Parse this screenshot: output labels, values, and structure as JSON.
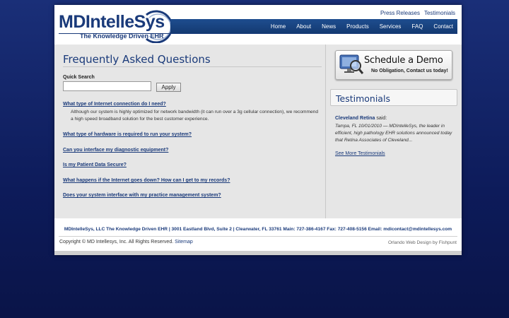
{
  "header": {
    "logo_text": "MDIntelleSys",
    "logo_tagline": "The Knowledge Driven EHR",
    "top_links": [
      "Press Releases",
      "Testimonials"
    ],
    "nav": [
      "Home",
      "About",
      "News",
      "Products",
      "Services",
      "FAQ",
      "Contact"
    ]
  },
  "main": {
    "title": "Frequently Asked Questions",
    "search_label": "Quick Search",
    "search_value": "",
    "search_button": "Apply",
    "questions": [
      "What type of Internet connection do I need?",
      "What type of hardware is required to run your system?",
      "Can you interface my diagnostic equipment?",
      "Is my Patient Data Secure?",
      "What happens if the Internet goes down? How can I get to my records?",
      "Does your system interface with my practice management system?"
    ],
    "first_answer": "Although our system is highly optimized for network bandwidth (it can run over a 3g cellular connection), we recommend a high speed broadband solution for the best customer experience."
  },
  "sidebar": {
    "demo_title": "Schedule a Demo",
    "demo_subtitle": "No Obligation, Contact us today!",
    "testimonials_title": "Testimonials",
    "testimonial_author": "Cleveland Retina",
    "testimonial_said": "said:",
    "testimonial_text": "Tampa, FL 10/01/2010 — MDIntelleSys, the leader in efficient, high pathology EHR solutions announced today that Retina Associates of Cleveland...",
    "see_more": "See More Testimonials"
  },
  "footer": {
    "address": "MDIntelleSys, LLC The Knowledge Driven EHR | 3001 Eastland Blvd, Suite 2 | Clearwater, FL 33761 Main: 727-386-4167 Fax: 727-408-5156 Email: mdicontact@mdintellesys.com",
    "copyright": "Copyright © MD Intellesys, Inc. All Rights Reserved.",
    "sitemap": "Sitemap",
    "credit_link": "Orlando Web Design",
    "credit_by": "by Fishpunt"
  },
  "colors": {
    "brand_blue": "#1a3a7a",
    "nav_blue": "#1e4d8f",
    "background_navy": "#0d1b5a"
  }
}
